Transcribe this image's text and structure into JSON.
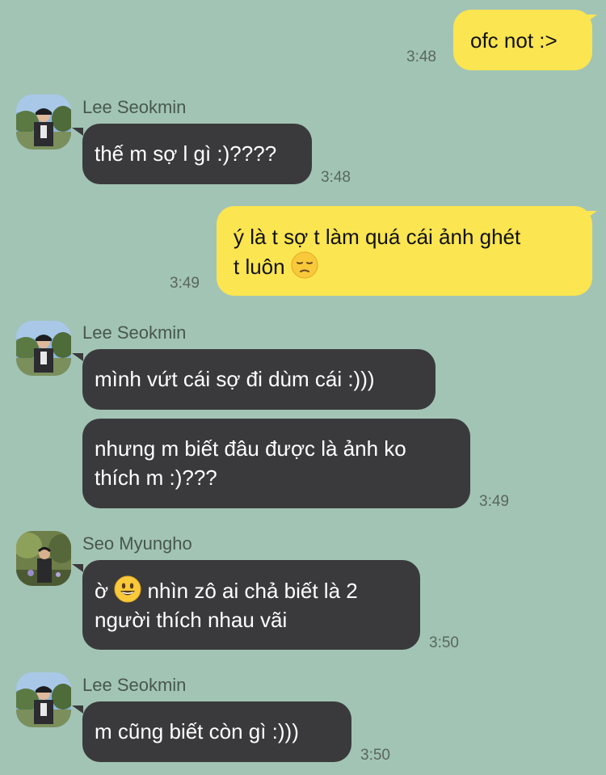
{
  "messages": [
    {
      "sender": "me",
      "text": "ofc not :>",
      "time": "3:48"
    },
    {
      "sender": "Lee Seokmin",
      "text": "thế m sợ l gì :)????",
      "time": "3:48"
    },
    {
      "sender": "me",
      "line1": "ý là t sợ t làm quá cái ảnh ghét",
      "line2": "t luôn",
      "emoji": "pensive-face",
      "time": "3:49"
    },
    {
      "sender": "Lee Seokmin",
      "text": "mình vứt cái sợ đi dùm cái :)))"
    },
    {
      "sender": "Lee Seokmin",
      "line1": "nhưng m biết đâu được là ảnh ko",
      "line2": "thích m :)???",
      "time": "3:49"
    },
    {
      "sender": "Seo Myungho",
      "line1_prefix": "ờ",
      "emoji": "smiling-face",
      "line1_suffix": "nhìn zô ai chả biết là 2",
      "line2": "người thích nhau vãi",
      "time": "3:50"
    },
    {
      "sender": "Lee Seokmin",
      "text": "m cũng biết còn gì :)))",
      "time": "3:50"
    }
  ],
  "contacts": {
    "lee": "Lee Seokmin",
    "seo": "Seo Myungho"
  },
  "colors": {
    "background": "#a2c4b5",
    "outgoing_bubble": "#fbe550",
    "incoming_bubble": "#3a3a3c",
    "timestamp": "#59675f"
  }
}
